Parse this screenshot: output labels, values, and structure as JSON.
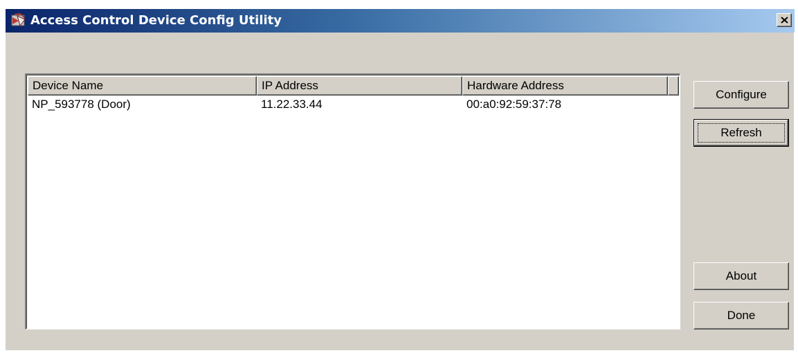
{
  "window": {
    "title": "Access Control Device Config Utility",
    "app_icon": "app-icon",
    "close_icon": "close-icon"
  },
  "device_list": {
    "columns": [
      "Device Name",
      "IP Address",
      "Hardware Address"
    ],
    "rows": [
      {
        "device_name": "NP_593778 (Door)",
        "ip_address": "11.22.33.44",
        "hardware_address": "00:a0:92:59:37:78"
      }
    ]
  },
  "buttons": {
    "configure": "Configure",
    "refresh": "Refresh",
    "about": "About",
    "done": "Done"
  },
  "colors": {
    "titlebar_start": "#0a246a",
    "titlebar_end": "#a6caf0",
    "face": "#d4d0c8"
  }
}
